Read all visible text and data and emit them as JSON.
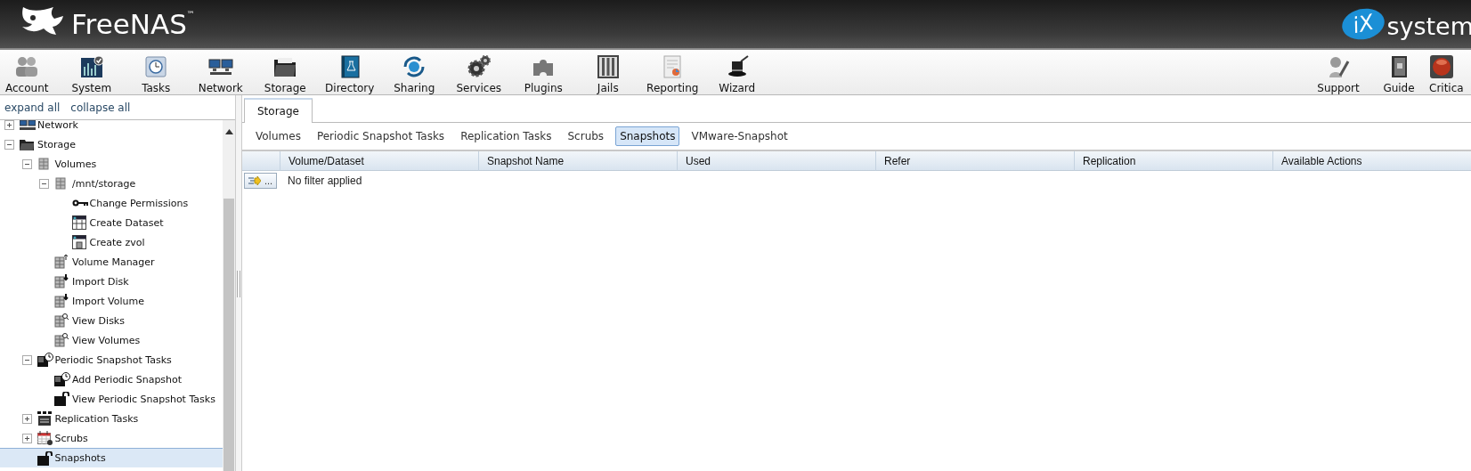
{
  "header": {
    "brand": "FreeNAS$^{™}$",
    "partner_mark": "iX",
    "partner": "system"
  },
  "toolbar": {
    "left": [
      {
        "label": "Account"
      },
      {
        "label": "System"
      },
      {
        "label": "Tasks"
      },
      {
        "label": "Network"
      },
      {
        "label": "Storage"
      },
      {
        "label": "Directory"
      },
      {
        "label": "Sharing"
      },
      {
        "label": "Services"
      },
      {
        "label": "Plugins"
      },
      {
        "label": "Jails"
      },
      {
        "label": "Reporting"
      },
      {
        "label": "Wizard"
      }
    ],
    "right": [
      {
        "label": "Support"
      },
      {
        "label": "Guide"
      },
      {
        "label": "Critica"
      }
    ]
  },
  "sidebar": {
    "links": [
      "expand all",
      "collapse all"
    ],
    "tree": [
      {
        "label": "Network",
        "expanded": false,
        "selected": false
      },
      {
        "label": "Storage",
        "expanded": true,
        "selected": false,
        "children": [
          {
            "label": "Volumes",
            "expanded": true,
            "selected": false,
            "children": [
              {
                "label": "/mnt/storage",
                "expanded": true,
                "selected": false,
                "children": [
                  {
                    "label": "Change Permissions",
                    "selected": false
                  },
                  {
                    "label": "Create Dataset",
                    "selected": false
                  },
                  {
                    "label": "Create zvol",
                    "selected": false
                  }
                ]
              },
              {
                "label": "Volume Manager",
                "selected": false
              },
              {
                "label": "Import Disk",
                "selected": false
              },
              {
                "label": "Import Volume",
                "selected": false
              },
              {
                "label": "View Disks",
                "selected": false
              },
              {
                "label": "View Volumes",
                "selected": false
              }
            ]
          },
          {
            "label": "Periodic Snapshot Tasks",
            "expanded": true,
            "selected": false,
            "children": [
              {
                "label": "Add Periodic Snapshot",
                "selected": false
              },
              {
                "label": "View Periodic Snapshot Tasks",
                "selected": false
              }
            ]
          },
          {
            "label": "Replication Tasks",
            "expanded": false,
            "selected": false
          },
          {
            "label": "Scrubs",
            "expanded": false,
            "selected": false
          },
          {
            "label": "Snapshots",
            "selected": true
          }
        ]
      }
    ]
  },
  "content": {
    "tabs": [
      {
        "label": "Storage",
        "selected": true
      }
    ],
    "subtabs": [
      {
        "label": "Volumes",
        "selected": false
      },
      {
        "label": "Periodic Snapshot Tasks",
        "selected": false
      },
      {
        "label": "Replication Tasks",
        "selected": false
      },
      {
        "label": "Scrubs",
        "selected": false
      },
      {
        "label": "Snapshots",
        "selected": true
      },
      {
        "label": "VMware-Snapshot",
        "selected": false
      }
    ],
    "table": {
      "columns": [
        "Volume/Dataset",
        "Snapshot Name",
        "Used",
        "Refer",
        "Replication",
        "Available Actions"
      ],
      "filter_button": "...",
      "filter_status": "No filter applied"
    }
  }
}
